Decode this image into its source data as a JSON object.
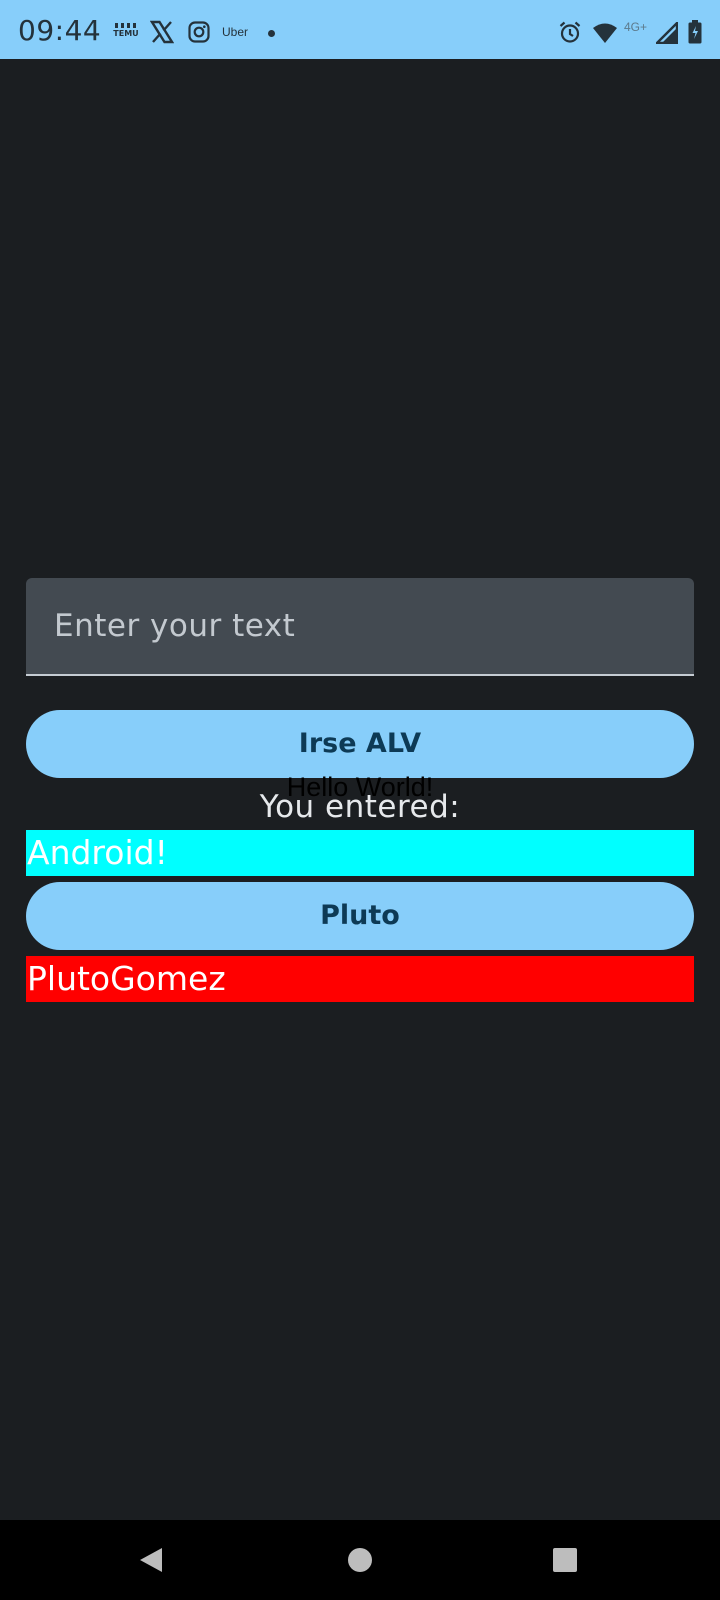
{
  "status_bar": {
    "time": "09:44",
    "temu_icon_label": "TEMU",
    "uber_label": "Uber",
    "network_label": "4G+",
    "background_color": "#87cefa",
    "notification_icons": [
      "temu-icon",
      "x-icon",
      "instagram-icon",
      "uber-icon",
      "dot-icon"
    ],
    "system_icons": [
      "alarm-icon",
      "wifi-icon",
      "signal-icon",
      "battery-icon"
    ]
  },
  "input": {
    "placeholder": "Enter your text",
    "value": ""
  },
  "buttons": {
    "primary_label": "Irse ALV",
    "secondary_label": "Pluto",
    "color": "#87cefa"
  },
  "labels": {
    "hello_world": "Hello World!",
    "you_entered": "You entered:"
  },
  "outputs": {
    "android_text": "Android!",
    "android_background": "#00ffff",
    "pluto_text": "PlutoGomez",
    "pluto_background": "#ff0000"
  },
  "navigation": {
    "icons": [
      "back-icon",
      "home-icon",
      "recents-icon"
    ]
  },
  "theme": {
    "background": "#1b1e21"
  }
}
